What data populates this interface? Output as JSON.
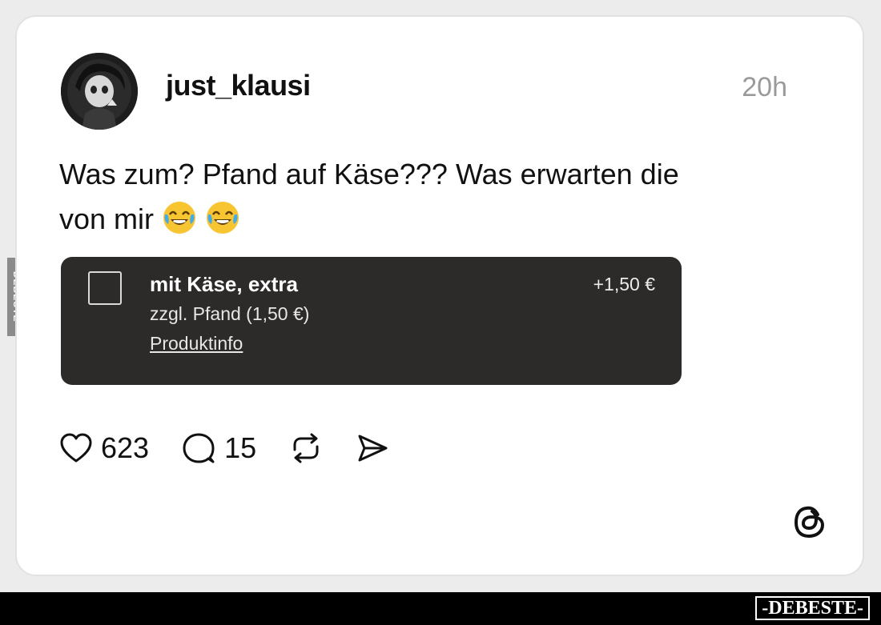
{
  "post": {
    "username": "just_klausi",
    "timestamp": "20h",
    "text_line1": "Was zum? Pfand auf Käse??? Was erwarten die",
    "text_line2": "von mir",
    "emojis": [
      "face-with-tears-of-joy",
      "face-with-tears-of-joy"
    ]
  },
  "addon": {
    "title": "mit Käse, extra",
    "subtitle": "zzgl. Pfand (1,50 €)",
    "link": "Produktinfo",
    "price": "+1,50 €",
    "checked": false
  },
  "actions": {
    "likes": "623",
    "comments": "15",
    "icons": [
      "heart-icon",
      "comment-icon",
      "repost-icon",
      "share-icon"
    ]
  },
  "branding": {
    "app_logo": "threads-logo",
    "watermark": "-DEBESTE-",
    "side_mark": "DEBESTE"
  },
  "colors": {
    "card_bg": "#ffffff",
    "addon_bg": "#2d2b29",
    "timestamp": "#9a9a9a",
    "text": "#111111"
  }
}
